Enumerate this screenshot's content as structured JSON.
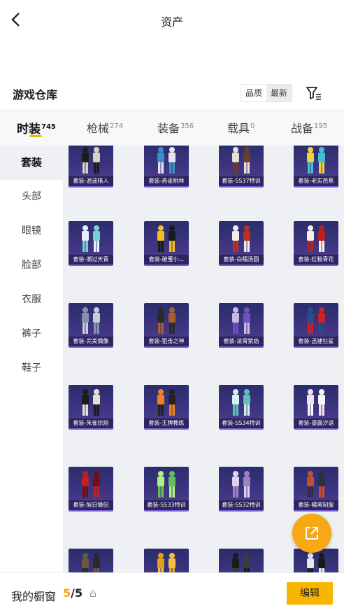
{
  "header": {
    "title": "资产"
  },
  "section": {
    "title": "游戏仓库",
    "sort": [
      {
        "label": "品质"
      },
      {
        "label": "最新"
      }
    ]
  },
  "tabs": [
    {
      "label": "时装",
      "count": "745"
    },
    {
      "label": "枪械",
      "count": "274"
    },
    {
      "label": "装备",
      "count": "356"
    },
    {
      "label": "载具",
      "count": "0"
    },
    {
      "label": "战备",
      "count": "195"
    }
  ],
  "sidebar": {
    "items": [
      {
        "label": "套装"
      },
      {
        "label": "头部"
      },
      {
        "label": "眼镜"
      },
      {
        "label": "脸部"
      },
      {
        "label": "衣服"
      },
      {
        "label": "裤子"
      },
      {
        "label": "鞋子"
      }
    ]
  },
  "items": [
    {
      "label": "套装-逍遥猎人"
    },
    {
      "label": "套装-燕雀桃林"
    },
    {
      "label": "套装-SS37特训"
    },
    {
      "label": "套装-老实芭蕉"
    },
    {
      "label": "套装-潮过天青"
    },
    {
      "label": "套装-破蜜小..."
    },
    {
      "label": "套装-白糯汤圆"
    },
    {
      "label": "套装-红釉青花"
    },
    {
      "label": "套装-完美偶像"
    },
    {
      "label": "套装-狙击之神"
    },
    {
      "label": "套装-凌霄紫焰"
    },
    {
      "label": "套装-迅捷狂鲨"
    },
    {
      "label": "套装-朱雀炽焰"
    },
    {
      "label": "套装-王牌教练"
    },
    {
      "label": "套装-SS34特训"
    },
    {
      "label": "套装-鎏露汐语"
    },
    {
      "label": "套装-旭日情侣"
    },
    {
      "label": "套装-SS33特训"
    },
    {
      "label": "套装-SS32特训"
    },
    {
      "label": "套装-橘黑制服"
    },
    {
      "label": ""
    },
    {
      "label": ""
    },
    {
      "label": ""
    },
    {
      "label": ""
    }
  ],
  "bottom": {
    "shelf_label": "我的橱窗",
    "shelf_current": "5",
    "shelf_total": "/5",
    "edit_label": "编辑"
  },
  "colors": {
    "accent": "#f5b800",
    "fab": "#f6a815",
    "card_bg": "#3d3480"
  },
  "icons": {
    "back": "back-icon",
    "filter": "filter-icon",
    "share": "share-icon",
    "lock": "lock-icon"
  }
}
